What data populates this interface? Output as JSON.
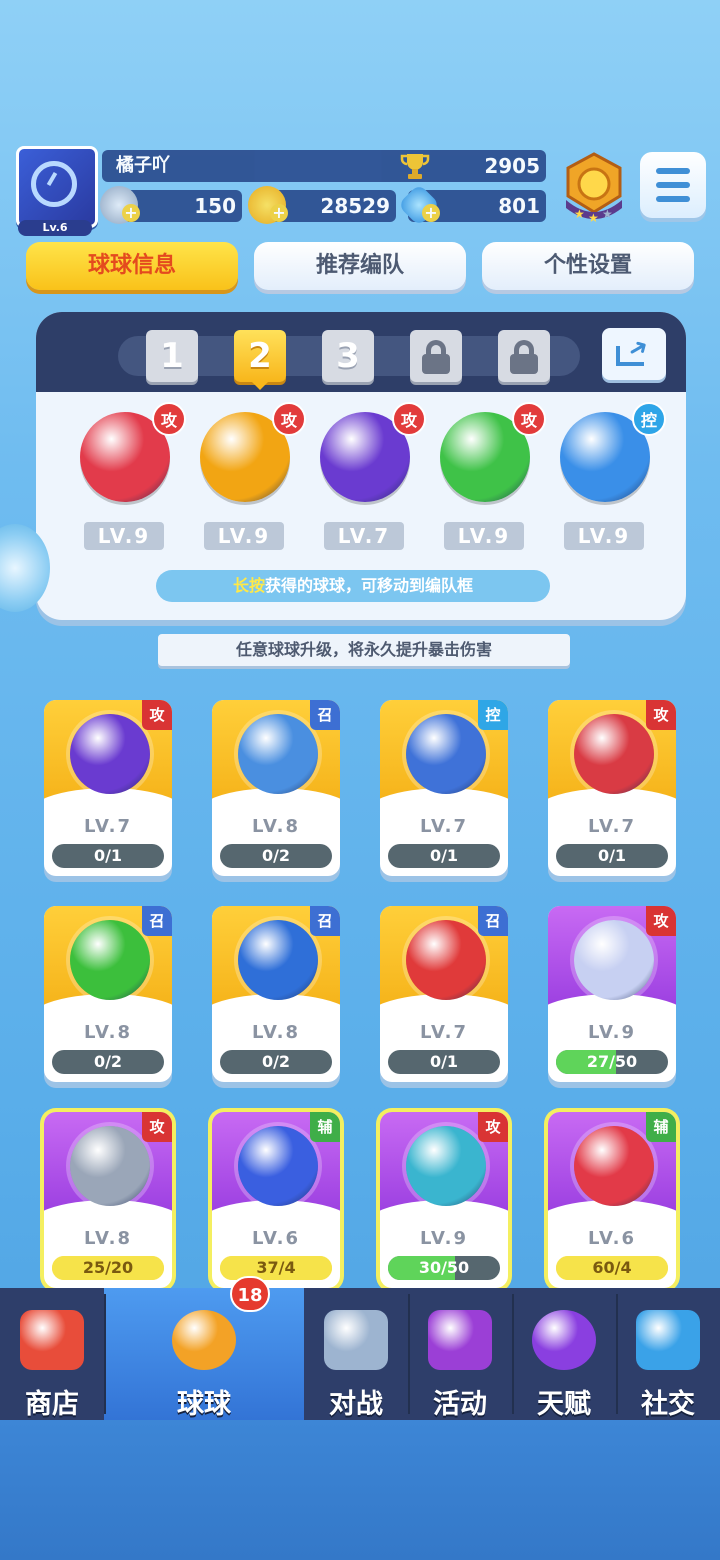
{
  "player": {
    "level": "Lv.6",
    "name": "橘子吖",
    "trophies": "2905",
    "stamina": "150",
    "coins": "28529",
    "gems": "801"
  },
  "tabs": [
    "球球信息",
    "推荐编队",
    "个性设置"
  ],
  "team_slots": [
    "1",
    "2",
    "3"
  ],
  "team": [
    {
      "role": "攻",
      "level": "LV.9",
      "color": "#e23b4b"
    },
    {
      "role": "攻",
      "level": "LV.9",
      "color": "#f2a513"
    },
    {
      "role": "攻",
      "level": "LV.7",
      "color": "#6a3bd0"
    },
    {
      "role": "攻",
      "level": "LV.9",
      "color": "#3fc248"
    },
    {
      "role": "控",
      "level": "LV.9",
      "color": "#3a8fe8"
    }
  ],
  "hint": {
    "highlight": "长按",
    "text": "获得的球球，可移动到编队框"
  },
  "notice": "任意球球升级，将永久提升暴击伤害",
  "balls": [
    {
      "role": "攻",
      "level": "LV.7",
      "progress": "0/1",
      "style": "gold",
      "color": "#6a3bd0",
      "fraction": 0
    },
    {
      "role": "召",
      "level": "LV.8",
      "progress": "0/2",
      "style": "gold",
      "color": "#4a8fe0",
      "fraction": 0
    },
    {
      "role": "控",
      "level": "LV.7",
      "progress": "0/1",
      "style": "gold",
      "color": "#3f72d8",
      "fraction": 0
    },
    {
      "role": "攻",
      "level": "LV.7",
      "progress": "0/1",
      "style": "gold",
      "color": "#d93b44",
      "fraction": 0
    },
    {
      "role": "召",
      "level": "LV.8",
      "progress": "0/2",
      "style": "gold",
      "color": "#3cbf3c",
      "fraction": 0
    },
    {
      "role": "召",
      "level": "LV.8",
      "progress": "0/2",
      "style": "gold",
      "color": "#2f6fd8",
      "fraction": 0
    },
    {
      "role": "召",
      "level": "LV.7",
      "progress": "0/1",
      "style": "gold",
      "color": "#e03a3a",
      "fraction": 0
    },
    {
      "role": "攻",
      "level": "LV.9",
      "progress": "27/50",
      "style": "purple",
      "color": "#c7d0f2",
      "fraction": 0.54
    },
    {
      "role": "攻",
      "level": "LV.8",
      "progress": "25/20",
      "style": "purple",
      "color": "#9aa6b8",
      "fraction": 1
    },
    {
      "role": "辅",
      "level": "LV.6",
      "progress": "37/4",
      "style": "purple",
      "color": "#3a5fe0",
      "fraction": 1
    },
    {
      "role": "攻",
      "level": "LV.9",
      "progress": "30/50",
      "style": "purple",
      "color": "#3ab5cf",
      "fraction": 0.6
    },
    {
      "role": "辅",
      "level": "LV.6",
      "progress": "60/4",
      "style": "purple",
      "color": "#e23a48",
      "fraction": 1
    }
  ],
  "nav": [
    {
      "label": "商店",
      "icon": "shop-icon"
    },
    {
      "label": "球球",
      "icon": "ball-icon",
      "badge": "18"
    },
    {
      "label": "对战",
      "icon": "swords-icon"
    },
    {
      "label": "活动",
      "icon": "party-popper-icon"
    },
    {
      "label": "天赋",
      "icon": "planet-icon"
    },
    {
      "label": "社交",
      "icon": "chat-icon"
    }
  ]
}
